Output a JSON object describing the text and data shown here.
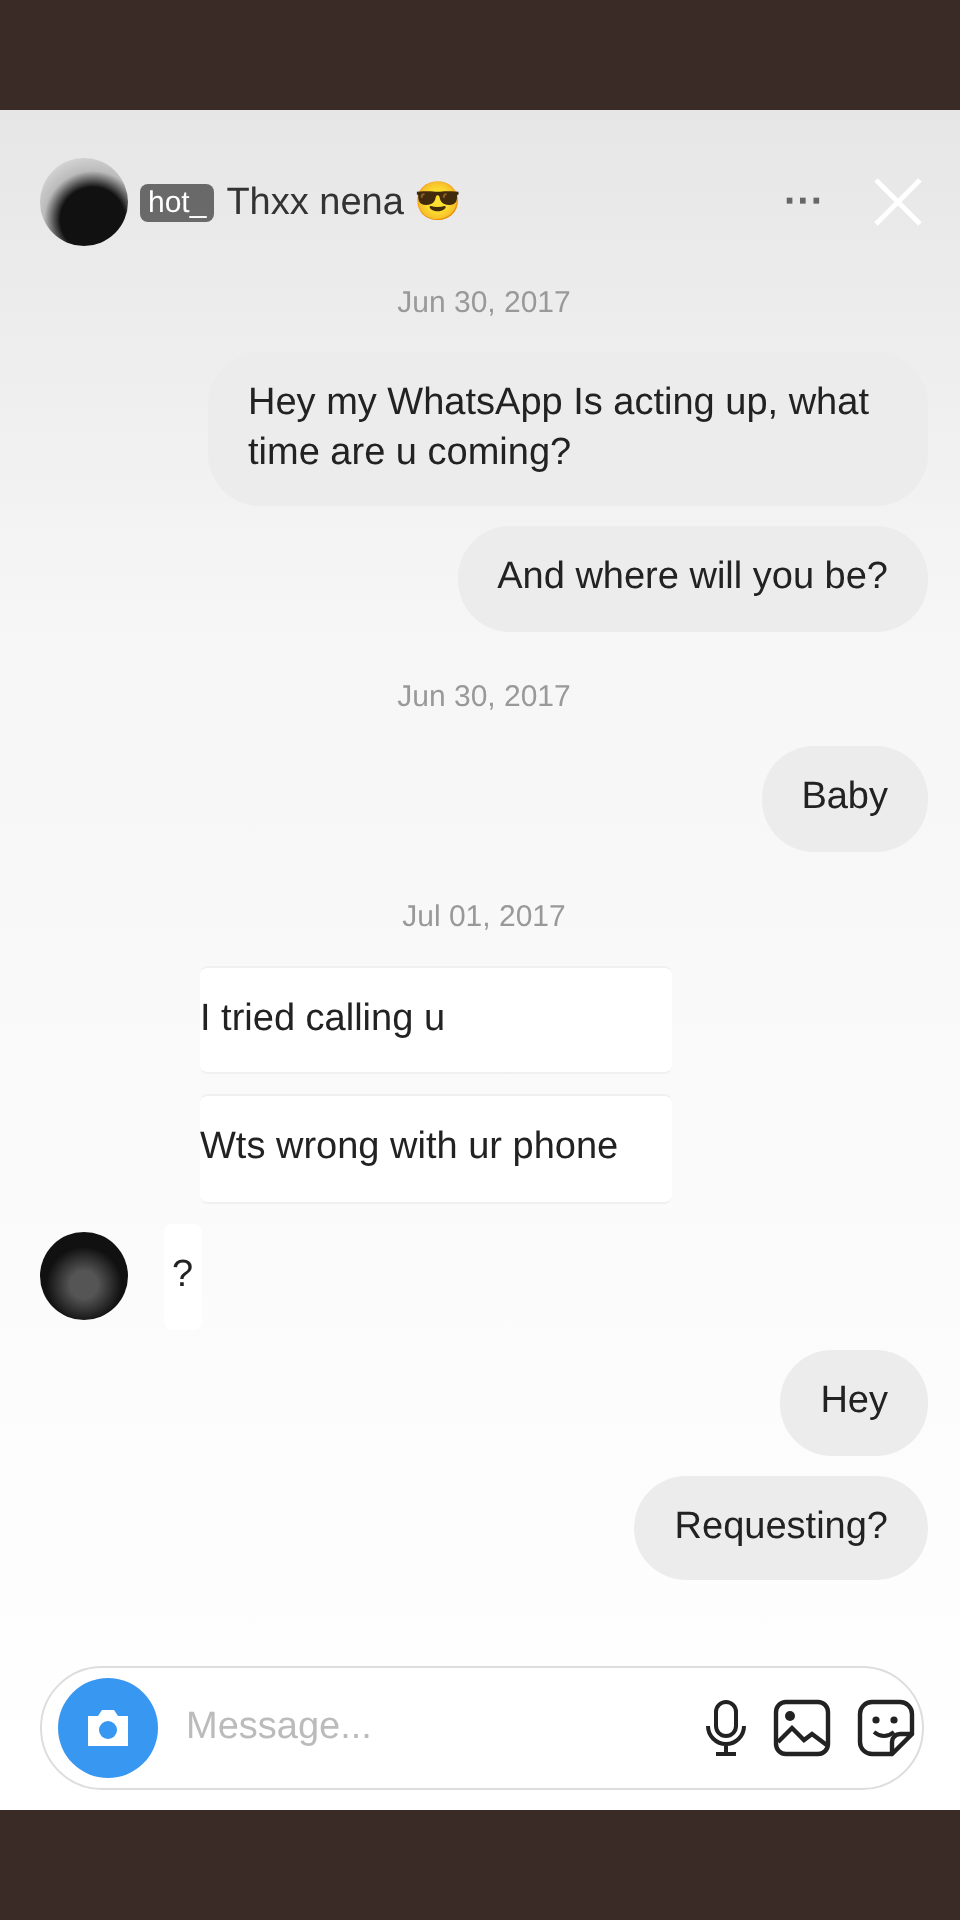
{
  "story_header": {
    "username": "hot_",
    "title": "Thxx nena 😎",
    "more": "···"
  },
  "messages": [
    {
      "kind": "date",
      "text": "Jun 30, 2017"
    },
    {
      "kind": "sent",
      "text": "Hey my WhatsApp Is acting up, what time are u coming?"
    },
    {
      "kind": "sent",
      "text": "And where will you be?"
    },
    {
      "kind": "date",
      "text": "Jun 30, 2017"
    },
    {
      "kind": "sent",
      "text": "Baby"
    },
    {
      "kind": "date",
      "text": "Jul 01, 2017"
    },
    {
      "kind": "received",
      "text": "I tried calling u"
    },
    {
      "kind": "received",
      "text": "Wts wrong with ur phone"
    },
    {
      "kind": "received_avatar",
      "text": "?"
    },
    {
      "kind": "sent",
      "text": "Hey"
    },
    {
      "kind": "sent",
      "text": "Requesting?"
    }
  ],
  "composer": {
    "placeholder": "Message..."
  }
}
